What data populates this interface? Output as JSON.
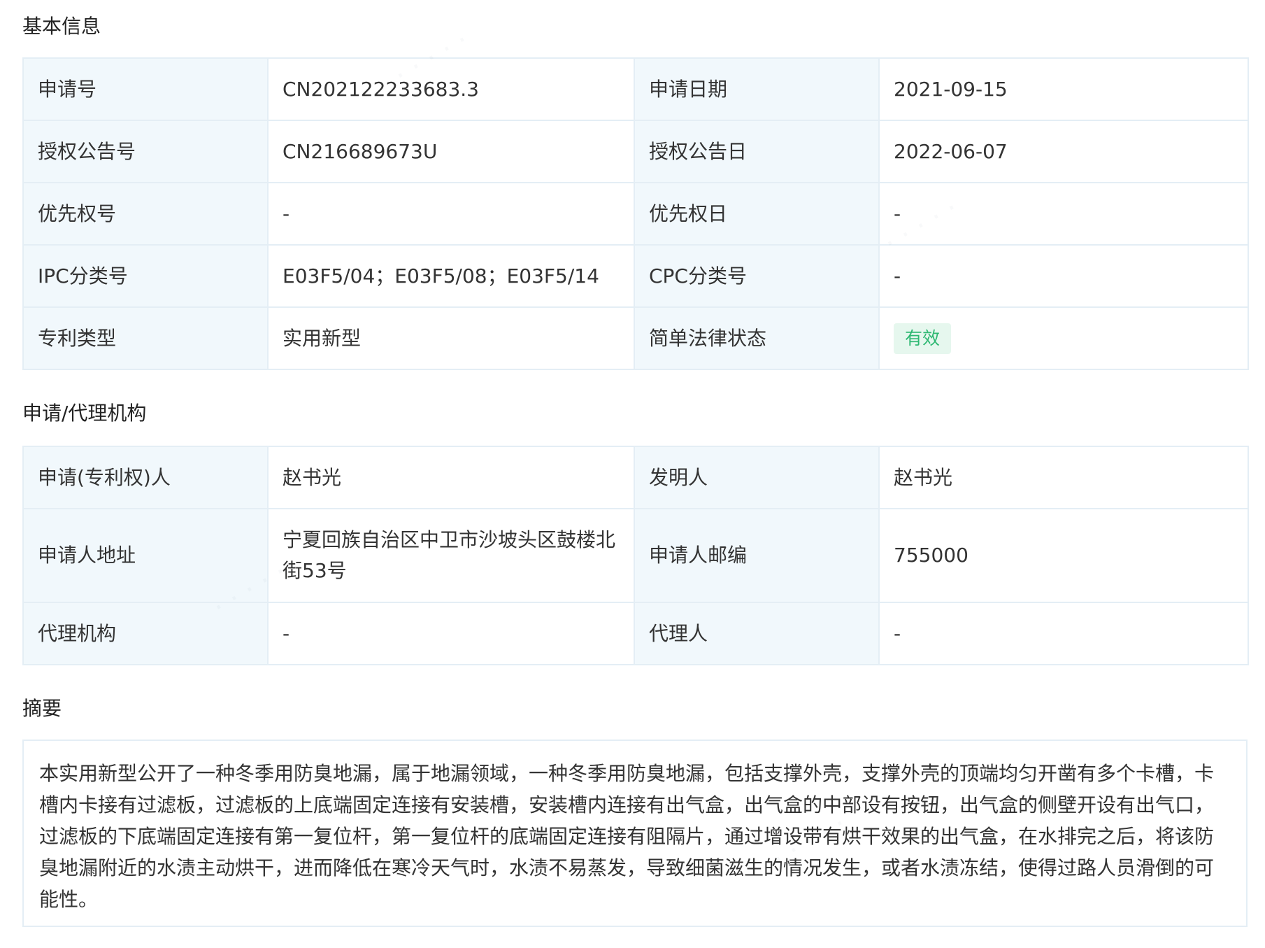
{
  "basic": {
    "title": "基本信息",
    "rows": [
      {
        "l1": "申请号",
        "v1": "CN202122233683.3",
        "l2": "申请日期",
        "v2": "2021-09-15"
      },
      {
        "l1": "授权公告号",
        "v1": "CN216689673U",
        "l2": "授权公告日",
        "v2": "2022-06-07"
      },
      {
        "l1": "优先权号",
        "v1": "-",
        "l2": "优先权日",
        "v2": "-"
      },
      {
        "l1": "IPC分类号",
        "v1": "E03F5/04；E03F5/08；E03F5/14",
        "l2": "CPC分类号",
        "v2": "-"
      },
      {
        "l1": "专利类型",
        "v1": "实用新型",
        "l2": "简单法律状态",
        "v2": "有效"
      }
    ]
  },
  "agency": {
    "title": "申请/代理机构",
    "rows": [
      {
        "l1": "申请(专利权)人",
        "v1": "赵书光",
        "l2": "发明人",
        "v2": "赵书光"
      },
      {
        "l1": "申请人地址",
        "v1": "宁夏回族自治区中卫市沙坡头区鼓楼北街53号",
        "l2": "申请人邮编",
        "v2": "755000"
      },
      {
        "l1": "代理机构",
        "v1": "-",
        "l2": "代理人",
        "v2": "-"
      }
    ]
  },
  "abstract": {
    "title": "摘要",
    "text": "本实用新型公开了一种冬季用防臭地漏，属于地漏领域，一种冬季用防臭地漏，包括支撑外壳，支撑外壳的顶端均匀开凿有多个卡槽，卡槽内卡接有过滤板，过滤板的上底端固定连接有安装槽，安装槽内连接有出气盒，出气盒的中部设有按钮，出气盒的侧壁开设有出气口，过滤板的下底端固定连接有第一复位杆，第一复位杆的底端固定连接有阻隔片，通过增设带有烘干效果的出气盒，在水排完之后，将该防臭地漏附近的水渍主动烘干，进而降低在寒冷天气时，水渍不易蒸发，导致细菌滋生的情况发生，或者水渍冻结，使得过路人员滑倒的可能性。"
  },
  "colors": {
    "label_bg": "#f1f8fc",
    "border": "#e4eef5",
    "status_bg": "#e6f7ee",
    "status_text": "#2eb872"
  }
}
